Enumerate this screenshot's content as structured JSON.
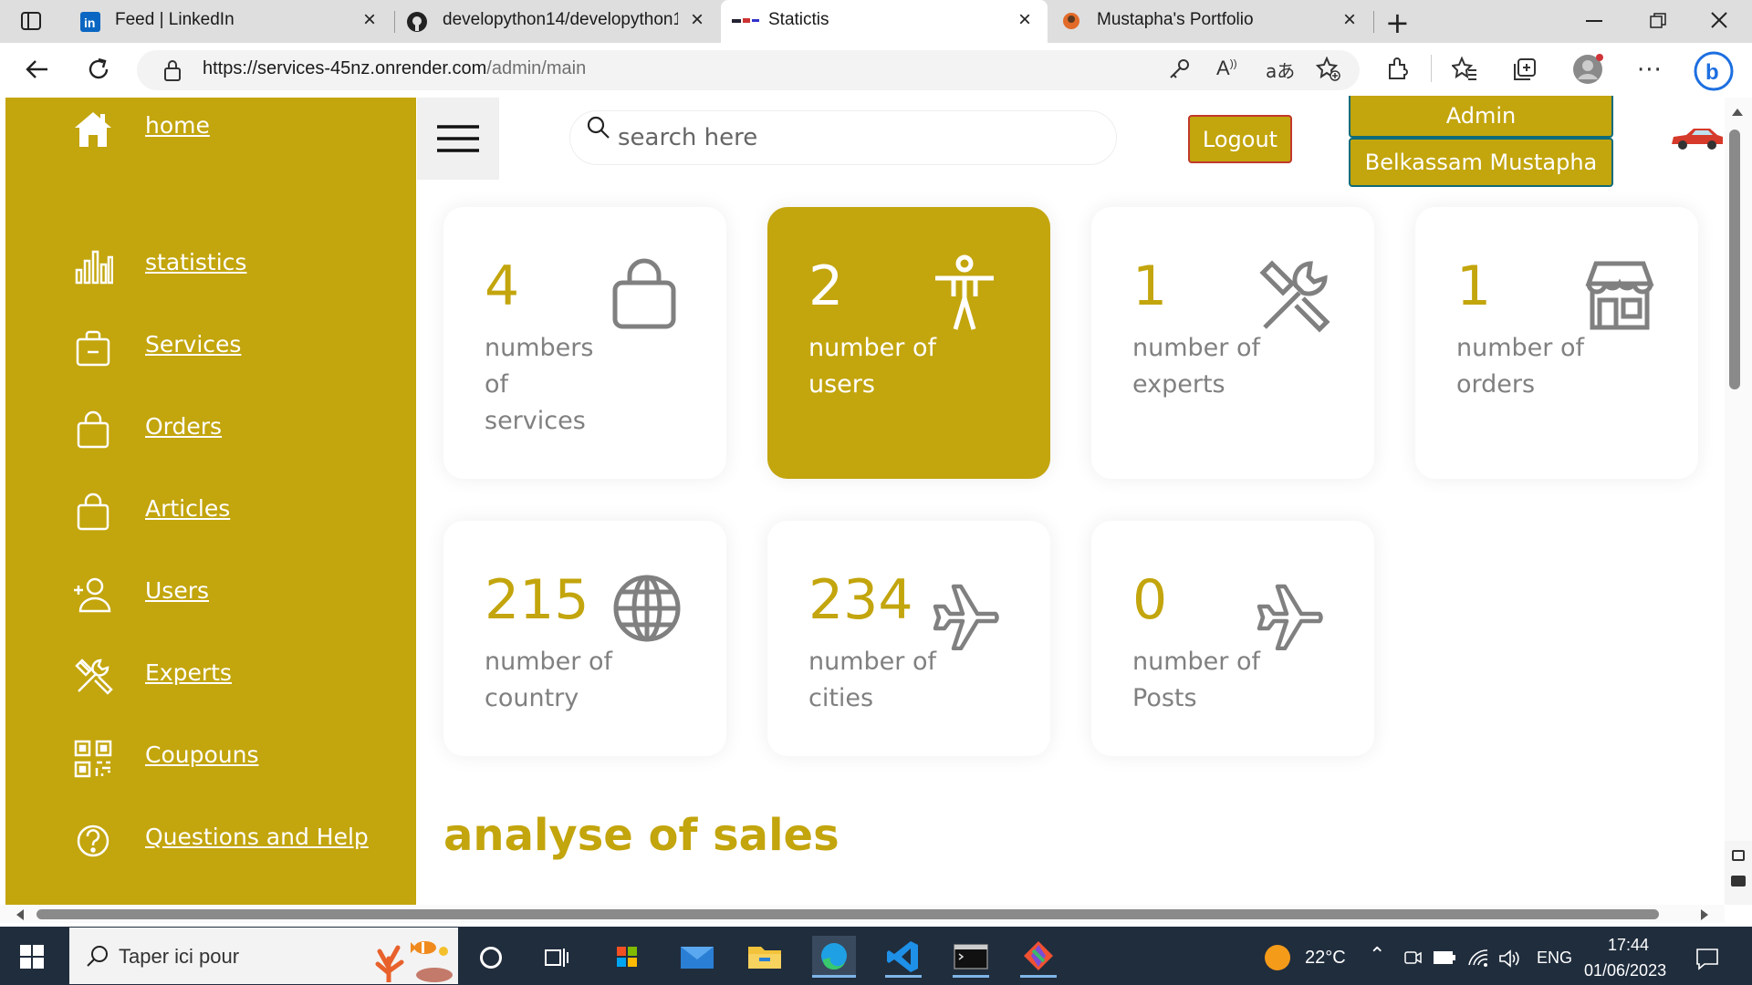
{
  "browser": {
    "tabs": [
      {
        "label": "Feed | LinkedIn",
        "active": false
      },
      {
        "label": "developython14/developython14",
        "active": false
      },
      {
        "label": "Statictis",
        "active": true
      },
      {
        "label": "Mustapha's Portfolio",
        "active": false
      }
    ],
    "url": {
      "host": "https://services-45nz.onrender.com",
      "path": "/admin/main"
    }
  },
  "sidebar": {
    "items": [
      {
        "label": "home",
        "icon": "home-icon"
      },
      {
        "label": "statistics",
        "icon": "bar-chart-icon"
      },
      {
        "label": "Services",
        "icon": "briefcase-icon"
      },
      {
        "label": "Orders",
        "icon": "shopping-bag-icon"
      },
      {
        "label": "Articles",
        "icon": "shopping-bag-icon"
      },
      {
        "label": "Users",
        "icon": "add-user-icon"
      },
      {
        "label": "Experts",
        "icon": "tools-icon"
      },
      {
        "label": "Coupouns",
        "icon": "qr-code-icon"
      },
      {
        "label": "Questions and Help",
        "icon": "help-circle-icon"
      }
    ]
  },
  "header": {
    "search_placeholder": "search here",
    "logout_label": "Logout",
    "role_label": "Admin",
    "user_name": "Belkassam Mustapha"
  },
  "stats": [
    {
      "value": "4",
      "label": "numbers of services",
      "icon": "bag-icon",
      "highlighted": false
    },
    {
      "value": "2",
      "label": "number of users",
      "icon": "person-icon",
      "highlighted": true
    },
    {
      "value": "1",
      "label": "number of experts",
      "icon": "tools-icon",
      "highlighted": false
    },
    {
      "value": "1",
      "label": "number of orders",
      "icon": "store-icon",
      "highlighted": false
    },
    {
      "value": "215",
      "label": "number of country",
      "icon": "globe-icon",
      "highlighted": false
    },
    {
      "value": "234",
      "label": "number of cities",
      "icon": "airplane-icon",
      "highlighted": false
    },
    {
      "value": "0",
      "label": "number of Posts",
      "icon": "airplane-icon",
      "highlighted": false
    }
  ],
  "section_title": "analyse of sales",
  "taskbar": {
    "search_text": "Taper ici pour",
    "weather": "22°C",
    "language": "ENG",
    "time": "17:44",
    "date": "01/06/2023"
  },
  "colors": {
    "accent": "#c3a50d",
    "taskbar": "#202d3d"
  }
}
